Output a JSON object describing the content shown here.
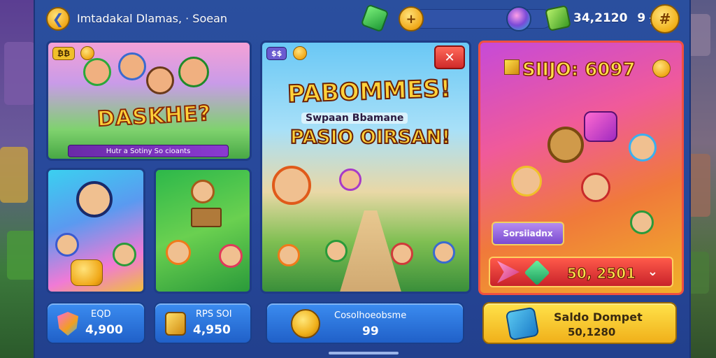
{
  "header": {
    "back_glyph": "❮",
    "title": "Imtadakal Dlamas, · Soean",
    "coin_glyph": "+",
    "balance": "34,2120",
    "balance_suffix": "9 ᵽ",
    "menu_glyph": "#"
  },
  "cards": {
    "daskhe": {
      "badge": "₿₿",
      "title": "DASKHE?",
      "banner": "Hutr a Sotiny So cioants"
    },
    "pabomnes": {
      "badge": "$$",
      "title": "PABOMMES!",
      "subtitle": "Swpaan Bbamane",
      "title2": "PASIO OIRSAN!",
      "close_label": "✕"
    },
    "promo": {
      "title": "SIIJO: 6097",
      "label": "Sorsiiadnx",
      "select_value": "50, 2501",
      "chevron": "⌄"
    }
  },
  "bottom": {
    "eqd": {
      "label": "EQD",
      "value": "4,900"
    },
    "rpm": {
      "label": "RPS SOI",
      "value": "4,950"
    },
    "mid": {
      "label": "Cosolhoeobsme",
      "value": "99"
    },
    "wallet": {
      "label": "Saldo Dompet",
      "value": "50,1280"
    }
  },
  "colors": {
    "frame": "#27479a",
    "accent_gold": "#f0b01a",
    "promo_border": "#f05040",
    "button_blue": "#2f76dc"
  }
}
